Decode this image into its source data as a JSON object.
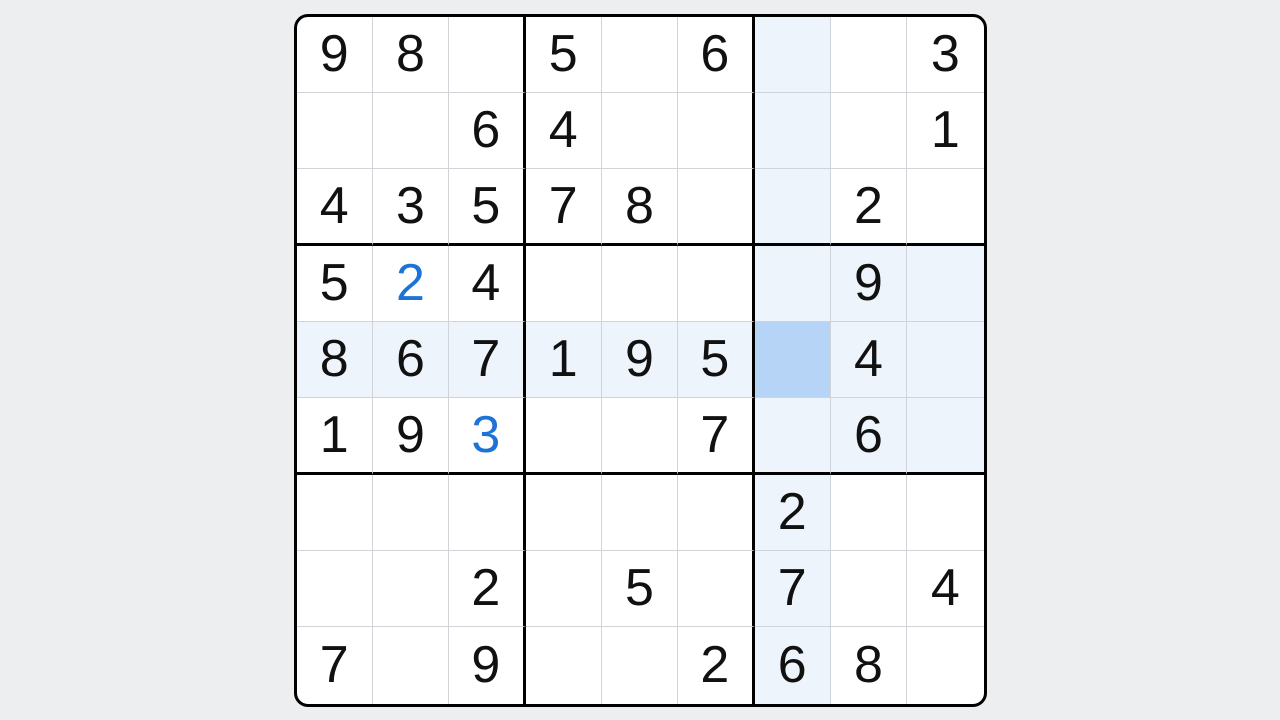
{
  "sudoku": {
    "selected": {
      "row": 5,
      "col": 7
    },
    "grid": [
      [
        {
          "v": "9",
          "g": true
        },
        {
          "v": "8",
          "g": true
        },
        {
          "v": "",
          "g": false
        },
        {
          "v": "5",
          "g": true
        },
        {
          "v": "",
          "g": false
        },
        {
          "v": "6",
          "g": true
        },
        {
          "v": "",
          "g": false
        },
        {
          "v": "",
          "g": false
        },
        {
          "v": "3",
          "g": true
        }
      ],
      [
        {
          "v": "",
          "g": false
        },
        {
          "v": "",
          "g": false
        },
        {
          "v": "6",
          "g": true
        },
        {
          "v": "4",
          "g": true
        },
        {
          "v": "",
          "g": false
        },
        {
          "v": "",
          "g": false
        },
        {
          "v": "",
          "g": false
        },
        {
          "v": "",
          "g": false
        },
        {
          "v": "1",
          "g": true
        }
      ],
      [
        {
          "v": "4",
          "g": true
        },
        {
          "v": "3",
          "g": true
        },
        {
          "v": "5",
          "g": true
        },
        {
          "v": "7",
          "g": true
        },
        {
          "v": "8",
          "g": true
        },
        {
          "v": "",
          "g": false
        },
        {
          "v": "",
          "g": false
        },
        {
          "v": "2",
          "g": true
        },
        {
          "v": "",
          "g": false
        }
      ],
      [
        {
          "v": "5",
          "g": true
        },
        {
          "v": "2",
          "g": false
        },
        {
          "v": "4",
          "g": true
        },
        {
          "v": "",
          "g": false
        },
        {
          "v": "",
          "g": false
        },
        {
          "v": "",
          "g": false
        },
        {
          "v": "",
          "g": false
        },
        {
          "v": "9",
          "g": true
        },
        {
          "v": "",
          "g": false
        }
      ],
      [
        {
          "v": "8",
          "g": true
        },
        {
          "v": "6",
          "g": true
        },
        {
          "v": "7",
          "g": true
        },
        {
          "v": "1",
          "g": true
        },
        {
          "v": "9",
          "g": true
        },
        {
          "v": "5",
          "g": true
        },
        {
          "v": "",
          "g": false
        },
        {
          "v": "4",
          "g": true
        },
        {
          "v": "",
          "g": false
        }
      ],
      [
        {
          "v": "1",
          "g": true
        },
        {
          "v": "9",
          "g": true
        },
        {
          "v": "3",
          "g": false
        },
        {
          "v": "",
          "g": false
        },
        {
          "v": "",
          "g": false
        },
        {
          "v": "7",
          "g": true
        },
        {
          "v": "",
          "g": false
        },
        {
          "v": "6",
          "g": true
        },
        {
          "v": "",
          "g": false
        }
      ],
      [
        {
          "v": "",
          "g": false
        },
        {
          "v": "",
          "g": false
        },
        {
          "v": "",
          "g": false
        },
        {
          "v": "",
          "g": false
        },
        {
          "v": "",
          "g": false
        },
        {
          "v": "",
          "g": false
        },
        {
          "v": "2",
          "g": true
        },
        {
          "v": "",
          "g": false
        },
        {
          "v": "",
          "g": false
        }
      ],
      [
        {
          "v": "",
          "g": false
        },
        {
          "v": "",
          "g": false
        },
        {
          "v": "2",
          "g": true
        },
        {
          "v": "",
          "g": false
        },
        {
          "v": "5",
          "g": true
        },
        {
          "v": "",
          "g": false
        },
        {
          "v": "7",
          "g": true
        },
        {
          "v": "",
          "g": false
        },
        {
          "v": "4",
          "g": true
        }
      ],
      [
        {
          "v": "7",
          "g": true
        },
        {
          "v": "",
          "g": false
        },
        {
          "v": "9",
          "g": true
        },
        {
          "v": "",
          "g": false
        },
        {
          "v": "",
          "g": false
        },
        {
          "v": "2",
          "g": true
        },
        {
          "v": "6",
          "g": true
        },
        {
          "v": "8",
          "g": true
        },
        {
          "v": "",
          "g": false
        }
      ]
    ]
  }
}
